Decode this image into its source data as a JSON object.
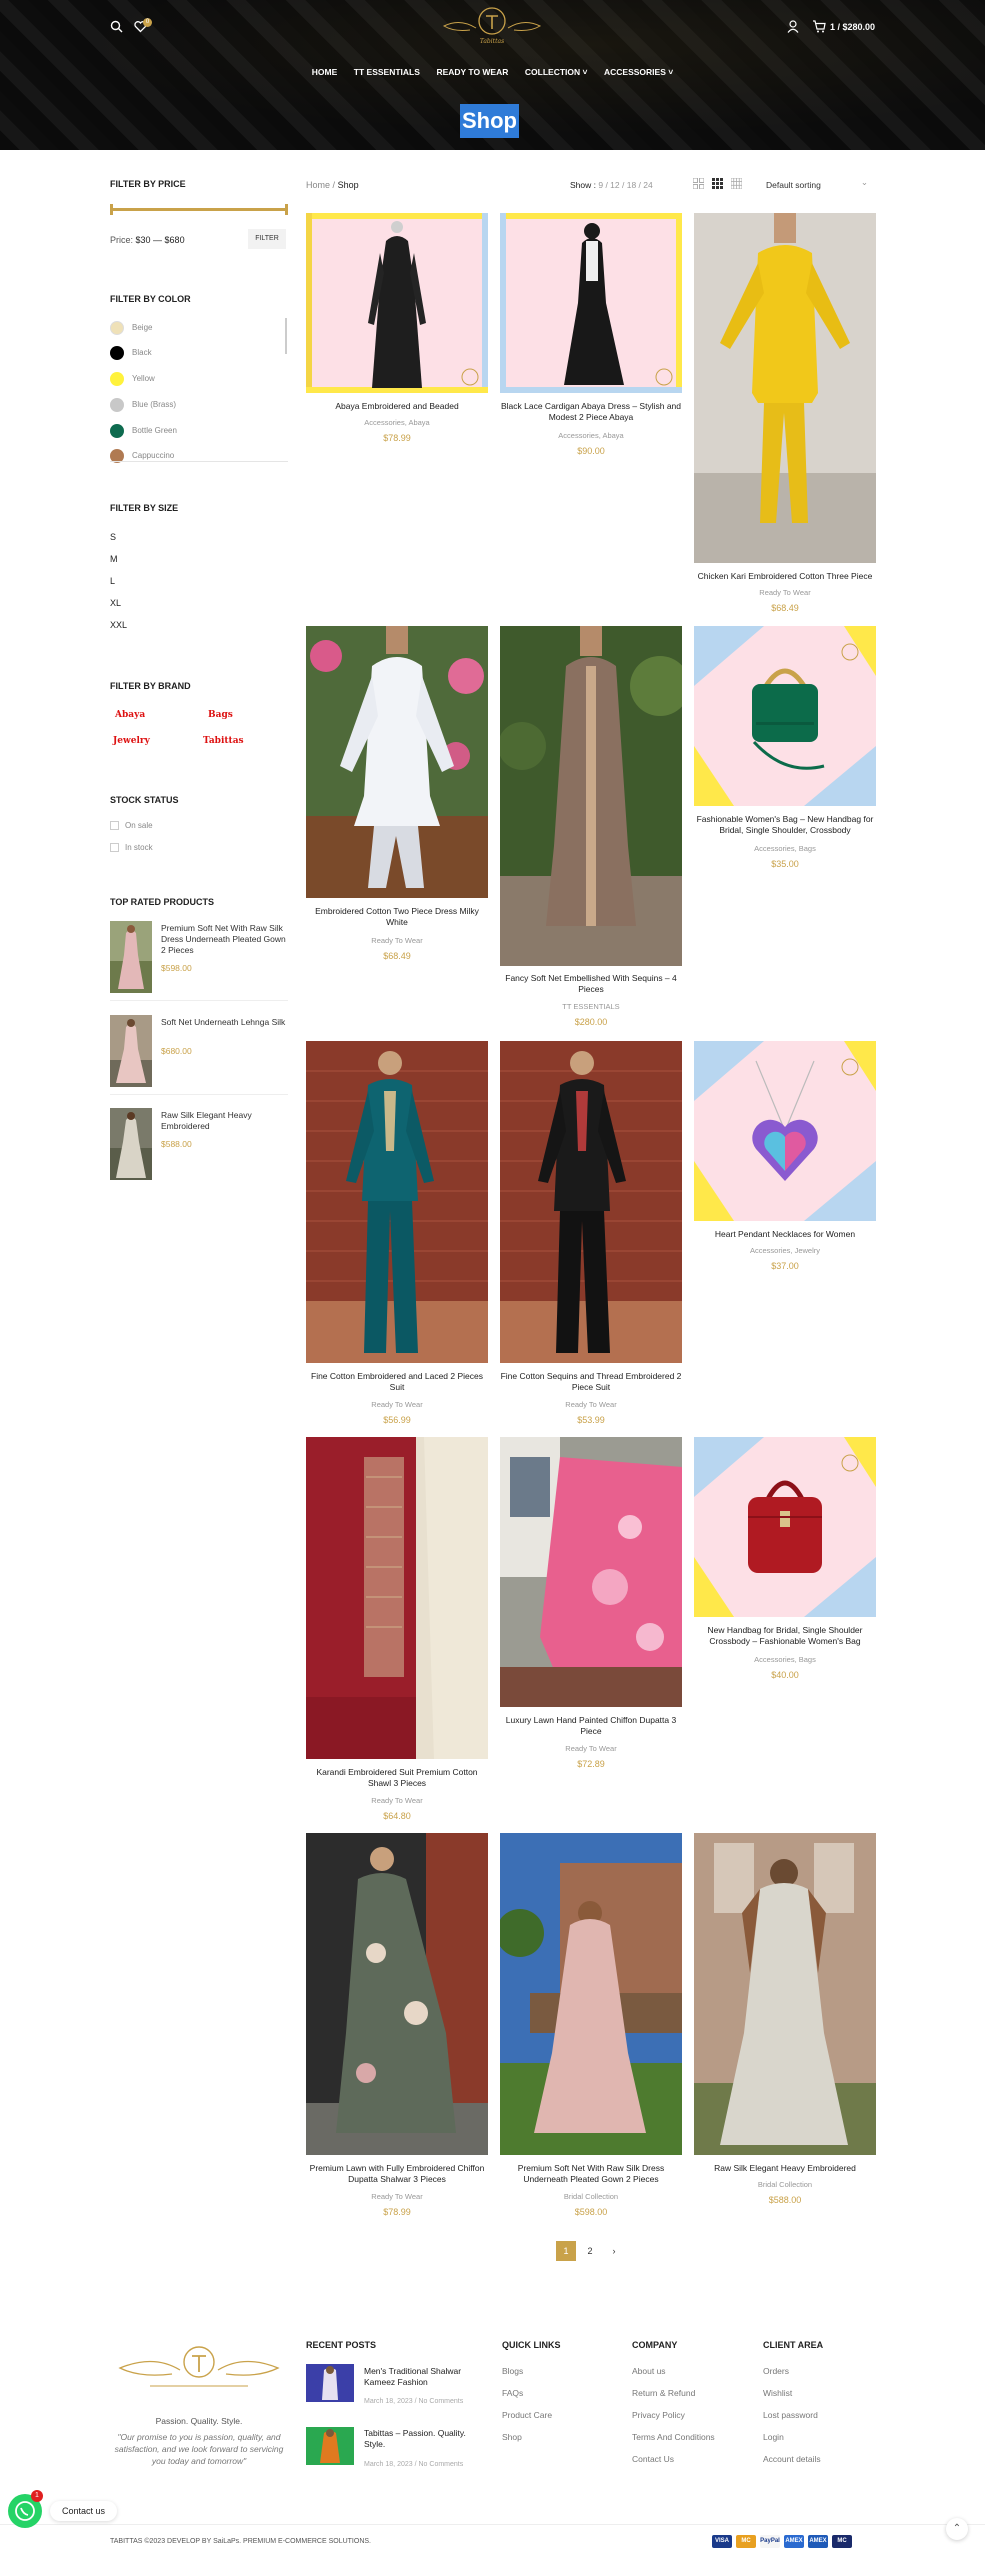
{
  "header": {
    "logo_text": "Tabittas",
    "cart_text": "1 / $280.00",
    "cart_count": "1",
    "wishlist_count": "0",
    "nav": [
      "HOME",
      "TT ESSENTIALS",
      "READY TO WEAR",
      "COLLECTION ˅",
      "ACCESSORIES ˅"
    ],
    "page_title": "Shop"
  },
  "sidebar": {
    "price_heading": "FILTER BY PRICE",
    "price_label": "Price:",
    "price_range": "$30 — $680",
    "filter_button": "FILTER",
    "color_heading": "FILTER BY COLOR",
    "colors": [
      {
        "name": "Beige",
        "hex": "#efe1b8"
      },
      {
        "name": "Black",
        "hex": "#000000"
      },
      {
        "name": "Yellow",
        "hex": "#fff23c"
      },
      {
        "name": "Blue (Brass)",
        "hex": "#c8c8c8"
      },
      {
        "name": "Bottle Green",
        "hex": "#0e6b4f"
      },
      {
        "name": "Cappuccino",
        "hex": "#b07a52"
      }
    ],
    "size_heading": "FILTER BY SIZE",
    "sizes": [
      "S",
      "M",
      "L",
      "XL",
      "XXL"
    ],
    "brand_heading": "FILTER BY BRAND",
    "brands": [
      "Abaya",
      "Bags",
      "Jewelry",
      "Tabittas"
    ],
    "stock_heading": "STOCK STATUS",
    "stock": [
      "On sale",
      "In stock"
    ],
    "top_heading": "TOP RATED PRODUCTS",
    "top_products": [
      {
        "name": "Premium Soft Net With Raw Silk Dress Underneath Pleated Gown 2 Pieces",
        "price": "$598.00"
      },
      {
        "name": "Soft Net Underneath Lehnga Silk",
        "price": "$680.00"
      },
      {
        "name": "Raw Silk Elegant Heavy Embroidered",
        "price": "$588.00"
      }
    ]
  },
  "toolbar": {
    "crumb_home": "Home",
    "crumb_sep": "/",
    "crumb_current": "Shop",
    "show_label": "Show :",
    "show_options": "9 / 12 / 18 / 24",
    "sorting": "Default sorting"
  },
  "products": [
    {
      "name": "Abaya Embroidered and Beaded",
      "cat": "Accessories, Abaya",
      "price": "$78.99"
    },
    {
      "name": "Black Lace Cardigan Abaya Dress – Stylish and Modest 2 Piece Abaya",
      "cat": "Accessories, Abaya",
      "price": "$90.00"
    },
    {
      "name": "Chicken Kari Embroidered Cotton Three Piece",
      "cat": "Ready To Wear",
      "price": "$68.49"
    },
    {
      "name": "Embroidered Cotton Two Piece Dress Milky White",
      "cat": "Ready To Wear",
      "price": "$68.49"
    },
    {
      "name": "Fancy Soft Net Embellished With Sequins – 4 Pieces",
      "cat": "TT ESSENTIALS",
      "price": "$280.00"
    },
    {
      "name": "Fashionable Women's Bag – New Handbag for Bridal, Single Shoulder, Crossbody",
      "cat": "Accessories, Bags",
      "price": "$35.00"
    },
    {
      "name": "Fine Cotton Embroidered and Laced 2 Pieces Suit",
      "cat": "Ready To Wear",
      "price": "$56.99"
    },
    {
      "name": "Fine Cotton Sequins and Thread Embroidered 2 Piece Suit",
      "cat": "Ready To Wear",
      "price": "$53.99"
    },
    {
      "name": "Heart Pendant Necklaces for Women",
      "cat": "Accessories, Jewelry",
      "price": "$37.00"
    },
    {
      "name": "Karandi Embroidered Suit Premium Cotton Shawl 3 Pieces",
      "cat": "Ready To Wear",
      "price": "$64.80"
    },
    {
      "name": "Luxury Lawn Hand Painted Chiffon Dupatta 3 Piece",
      "cat": "Ready To Wear",
      "price": "$72.89"
    },
    {
      "name": "New Handbag for Bridal, Single Shoulder Crossbody – Fashionable Women's Bag",
      "cat": "Accessories, Bags",
      "price": "$40.00"
    },
    {
      "name": "Premium Lawn with Fully Embroidered Chiffon Dupatta Shalwar 3 Pieces",
      "cat": "Ready To Wear",
      "price": "$78.99"
    },
    {
      "name": "Premium Soft Net With Raw Silk Dress Underneath Pleated Gown 2 Pieces",
      "cat": "Bridal Collection",
      "price": "$598.00"
    },
    {
      "name": "Raw Silk Elegant Heavy Embroidered",
      "cat": "Bridal Collection",
      "price": "$588.00"
    }
  ],
  "pagination": {
    "p1": "1",
    "p2": "2",
    "next": "›"
  },
  "footer": {
    "tagline": "Passion. Quality. Style.",
    "quote": "\"Our promise to you is passion, quality, and satisfaction, and we look forward to servicing you today and tomorrow\"",
    "recent_heading": "RECENT POSTS",
    "posts": [
      {
        "title": "Men's Traditional Shalwar Kameez Fashion",
        "date": "March 18, 2023",
        "comments": "No Comments"
      },
      {
        "title": "Tabittas – Passion. Quality. Style.",
        "date": "March 18, 2023",
        "comments": "No Comments"
      }
    ],
    "quick_heading": "QUICK LINKS",
    "quick": [
      "Blogs",
      "FAQs",
      "Product Care",
      "Shop"
    ],
    "company_heading": "COMPANY",
    "company": [
      "About us",
      "Return & Refund",
      "Privacy Policy",
      "Terms And Conditions",
      "Contact Us"
    ],
    "client_heading": "CLIENT AREA",
    "client": [
      "Orders",
      "Wishlist",
      "Lost password",
      "Login",
      "Account details"
    ],
    "copyright": "TABITTAS ©2023 DEVELOP BY SaiLaPs. PREMIUM E-COMMERCE SOLUTIONS.",
    "payments": [
      "VISA",
      "MC",
      "PayPal",
      "AMEX",
      "AMEX",
      "MC"
    ]
  },
  "whatsapp": {
    "label": "Contact us",
    "badge": "1"
  }
}
